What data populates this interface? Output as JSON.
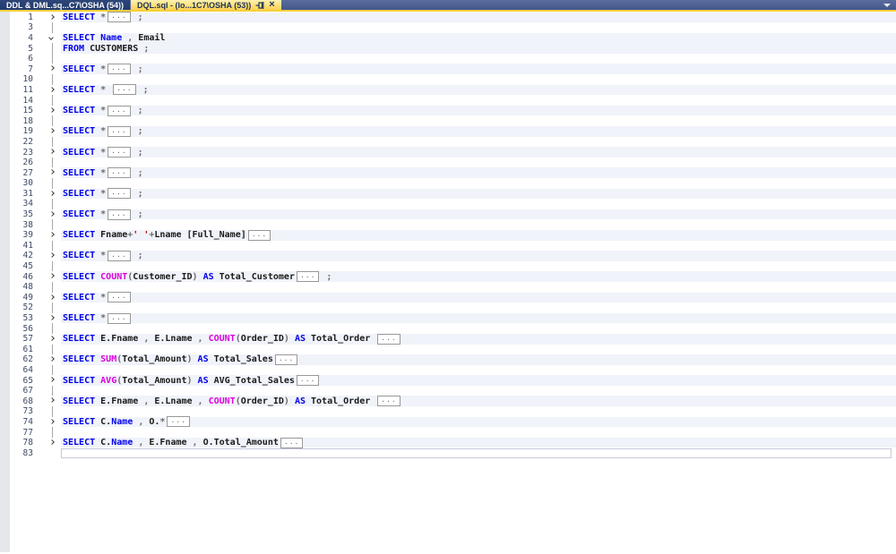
{
  "tab_bar": {
    "tabs": [
      {
        "label": "DDL & DML.sq...C7\\OSHA (54))",
        "state": "inactive"
      },
      {
        "label": "DQL.sql - (lo...1C7\\OSHA (53))",
        "state": "active"
      }
    ],
    "active_tab_icons": [
      "pin-icon",
      "close-icon"
    ],
    "close_glyph": "×",
    "accent_color": "#f6cf3d",
    "bar_color": "#42578b",
    "active_tab_color": "#fcd250"
  },
  "editor": {
    "language": "SQL",
    "band_color": "#f0f3f9",
    "keyword_color": "#0000e8",
    "function_color": "#dc00dc",
    "string_color": "#c00000",
    "fold_box_text": "...",
    "rows": [
      {
        "n": "1",
        "m": "c",
        "b": 1,
        "cur": 0,
        "s": [
          [
            "kw",
            "SELECT"
          ],
          [
            "op",
            " *"
          ],
          [
            "F",
            ""
          ],
          [
            "op",
            " ;"
          ]
        ]
      },
      {
        "n": "3",
        "m": "g",
        "b": 0,
        "cur": 0,
        "s": []
      },
      {
        "n": "4",
        "m": "e",
        "b": 1,
        "cur": 0,
        "s": [
          [
            "kw",
            "SELECT Name"
          ],
          [
            "op",
            " , "
          ],
          [
            "id",
            "Email"
          ]
        ]
      },
      {
        "n": "5",
        "m": "g",
        "b": 1,
        "cur": 0,
        "s": [
          [
            "kw",
            "FROM "
          ],
          [
            "id",
            "CUSTOMERS"
          ],
          [
            "op",
            " ;"
          ]
        ]
      },
      {
        "n": "6",
        "m": "g",
        "b": 0,
        "cur": 0,
        "s": []
      },
      {
        "n": "7",
        "m": "c",
        "b": 1,
        "cur": 0,
        "s": [
          [
            "kw",
            "SELECT"
          ],
          [
            "op",
            " *"
          ],
          [
            "F",
            ""
          ],
          [
            "op",
            " ;"
          ]
        ]
      },
      {
        "n": "10",
        "m": "g",
        "b": 0,
        "cur": 0,
        "s": []
      },
      {
        "n": "11",
        "m": "c",
        "b": 1,
        "cur": 0,
        "s": [
          [
            "kw",
            "SELECT"
          ],
          [
            "op",
            " * "
          ],
          [
            "F",
            ""
          ],
          [
            "op",
            " ;"
          ]
        ]
      },
      {
        "n": "14",
        "m": "g",
        "b": 0,
        "cur": 0,
        "s": []
      },
      {
        "n": "15",
        "m": "c",
        "b": 1,
        "cur": 0,
        "s": [
          [
            "kw",
            "SELECT"
          ],
          [
            "op",
            " *"
          ],
          [
            "F",
            ""
          ],
          [
            "op",
            " ;"
          ]
        ]
      },
      {
        "n": "18",
        "m": "g",
        "b": 0,
        "cur": 0,
        "s": []
      },
      {
        "n": "19",
        "m": "c",
        "b": 1,
        "cur": 0,
        "s": [
          [
            "kw",
            "SELECT"
          ],
          [
            "op",
            " *"
          ],
          [
            "F",
            ""
          ],
          [
            "op",
            " ;"
          ]
        ]
      },
      {
        "n": "22",
        "m": "g",
        "b": 0,
        "cur": 0,
        "s": []
      },
      {
        "n": "23",
        "m": "c",
        "b": 1,
        "cur": 0,
        "s": [
          [
            "kw",
            "SELECT"
          ],
          [
            "op",
            " *"
          ],
          [
            "F",
            ""
          ],
          [
            "op",
            " ;"
          ]
        ]
      },
      {
        "n": "26",
        "m": "g",
        "b": 0,
        "cur": 0,
        "s": []
      },
      {
        "n": "27",
        "m": "c",
        "b": 1,
        "cur": 0,
        "s": [
          [
            "kw",
            "SELECT"
          ],
          [
            "op",
            " *"
          ],
          [
            "F",
            ""
          ],
          [
            "op",
            " ;"
          ]
        ]
      },
      {
        "n": "30",
        "m": "g",
        "b": 0,
        "cur": 0,
        "s": []
      },
      {
        "n": "31",
        "m": "c",
        "b": 1,
        "cur": 0,
        "s": [
          [
            "kw",
            "SELECT"
          ],
          [
            "op",
            " *"
          ],
          [
            "F",
            ""
          ],
          [
            "op",
            " ;"
          ]
        ]
      },
      {
        "n": "34",
        "m": "g",
        "b": 0,
        "cur": 0,
        "s": []
      },
      {
        "n": "35",
        "m": "c",
        "b": 1,
        "cur": 0,
        "s": [
          [
            "kw",
            "SELECT"
          ],
          [
            "op",
            " *"
          ],
          [
            "F",
            ""
          ],
          [
            "op",
            " ;"
          ]
        ]
      },
      {
        "n": "38",
        "m": "g",
        "b": 0,
        "cur": 0,
        "s": []
      },
      {
        "n": "39",
        "m": "c",
        "b": 1,
        "cur": 0,
        "s": [
          [
            "kw",
            "SELECT "
          ],
          [
            "id",
            "Fname"
          ],
          [
            "op",
            "+"
          ],
          [
            "str",
            "' '"
          ],
          [
            "op",
            "+"
          ],
          [
            "id",
            "Lname [Full_Name]"
          ],
          [
            "F",
            ""
          ]
        ]
      },
      {
        "n": "41",
        "m": "g",
        "b": 0,
        "cur": 0,
        "s": []
      },
      {
        "n": "42",
        "m": "c",
        "b": 1,
        "cur": 0,
        "s": [
          [
            "kw",
            "SELECT"
          ],
          [
            "op",
            " *"
          ],
          [
            "F",
            ""
          ],
          [
            "op",
            " ;"
          ]
        ]
      },
      {
        "n": "45",
        "m": "g",
        "b": 0,
        "cur": 0,
        "s": []
      },
      {
        "n": "46",
        "m": "c",
        "b": 1,
        "cur": 0,
        "s": [
          [
            "kw",
            "SELECT "
          ],
          [
            "fn",
            "COUNT"
          ],
          [
            "op",
            "("
          ],
          [
            "id",
            "Customer_ID"
          ],
          [
            "op",
            ") "
          ],
          [
            "kw",
            "AS"
          ],
          [
            "id",
            " Total_Customer"
          ],
          [
            "F",
            ""
          ],
          [
            "op",
            " ;"
          ]
        ]
      },
      {
        "n": "48",
        "m": "g",
        "b": 0,
        "cur": 0,
        "s": []
      },
      {
        "n": "49",
        "m": "c",
        "b": 1,
        "cur": 0,
        "s": [
          [
            "kw",
            "SELECT"
          ],
          [
            "op",
            " *"
          ],
          [
            "F",
            ""
          ]
        ]
      },
      {
        "n": "52",
        "m": "g",
        "b": 0,
        "cur": 0,
        "s": []
      },
      {
        "n": "53",
        "m": "c",
        "b": 1,
        "cur": 0,
        "s": [
          [
            "kw",
            "SELECT"
          ],
          [
            "op",
            " *"
          ],
          [
            "F",
            ""
          ]
        ]
      },
      {
        "n": "56",
        "m": "g",
        "b": 0,
        "cur": 0,
        "s": []
      },
      {
        "n": "57",
        "m": "c",
        "b": 1,
        "cur": 0,
        "s": [
          [
            "kw",
            "SELECT "
          ],
          [
            "id",
            "E.Fname"
          ],
          [
            "op",
            " , "
          ],
          [
            "id",
            "E.Lname"
          ],
          [
            "op",
            " , "
          ],
          [
            "fn",
            "COUNT"
          ],
          [
            "op",
            "("
          ],
          [
            "id",
            "Order_ID"
          ],
          [
            "op",
            ") "
          ],
          [
            "kw",
            "AS"
          ],
          [
            "id",
            " Total_Order "
          ],
          [
            "F",
            ""
          ]
        ]
      },
      {
        "n": "61",
        "m": "g",
        "b": 0,
        "cur": 0,
        "s": []
      },
      {
        "n": "62",
        "m": "c",
        "b": 1,
        "cur": 0,
        "s": [
          [
            "kw",
            "SELECT "
          ],
          [
            "fn",
            "SUM"
          ],
          [
            "op",
            "("
          ],
          [
            "id",
            "Total_Amount"
          ],
          [
            "op",
            ") "
          ],
          [
            "kw",
            "AS"
          ],
          [
            "id",
            " Total_Sales"
          ],
          [
            "F",
            ""
          ]
        ]
      },
      {
        "n": "64",
        "m": "g",
        "b": 0,
        "cur": 0,
        "s": []
      },
      {
        "n": "65",
        "m": "c",
        "b": 1,
        "cur": 0,
        "s": [
          [
            "kw",
            "SELECT "
          ],
          [
            "fn",
            "AVG"
          ],
          [
            "op",
            "("
          ],
          [
            "id",
            "Total_Amount"
          ],
          [
            "op",
            ") "
          ],
          [
            "kw",
            "AS"
          ],
          [
            "id",
            " AVG_Total_Sales"
          ],
          [
            "F",
            ""
          ]
        ]
      },
      {
        "n": "67",
        "m": "g",
        "b": 0,
        "cur": 0,
        "s": []
      },
      {
        "n": "68",
        "m": "c",
        "b": 1,
        "cur": 0,
        "s": [
          [
            "kw",
            "SELECT "
          ],
          [
            "id",
            "E.Fname"
          ],
          [
            "op",
            " , "
          ],
          [
            "id",
            "E.Lname"
          ],
          [
            "op",
            " , "
          ],
          [
            "fn",
            "COUNT"
          ],
          [
            "op",
            "("
          ],
          [
            "id",
            "Order_ID"
          ],
          [
            "op",
            ") "
          ],
          [
            "kw",
            "AS"
          ],
          [
            "id",
            " Total_Order "
          ],
          [
            "F",
            ""
          ]
        ]
      },
      {
        "n": "73",
        "m": "g",
        "b": 0,
        "cur": 0,
        "s": []
      },
      {
        "n": "74",
        "m": "c",
        "b": 1,
        "cur": 0,
        "s": [
          [
            "kw",
            "SELECT "
          ],
          [
            "id",
            "C."
          ],
          [
            "kw",
            "Name"
          ],
          [
            "op",
            " , "
          ],
          [
            "id",
            "O."
          ],
          [
            "op",
            "*"
          ],
          [
            "F",
            ""
          ]
        ]
      },
      {
        "n": "77",
        "m": "g",
        "b": 0,
        "cur": 0,
        "s": []
      },
      {
        "n": "78",
        "m": "c",
        "b": 1,
        "cur": 0,
        "s": [
          [
            "kw",
            "SELECT "
          ],
          [
            "id",
            "C."
          ],
          [
            "kw",
            "Name"
          ],
          [
            "op",
            " , "
          ],
          [
            "id",
            "E.Fname"
          ],
          [
            "op",
            " , "
          ],
          [
            "id",
            "O.Total_Amount"
          ],
          [
            "F",
            ""
          ]
        ]
      },
      {
        "n": "83",
        "m": "n",
        "b": 0,
        "cur": 1,
        "s": []
      }
    ]
  }
}
